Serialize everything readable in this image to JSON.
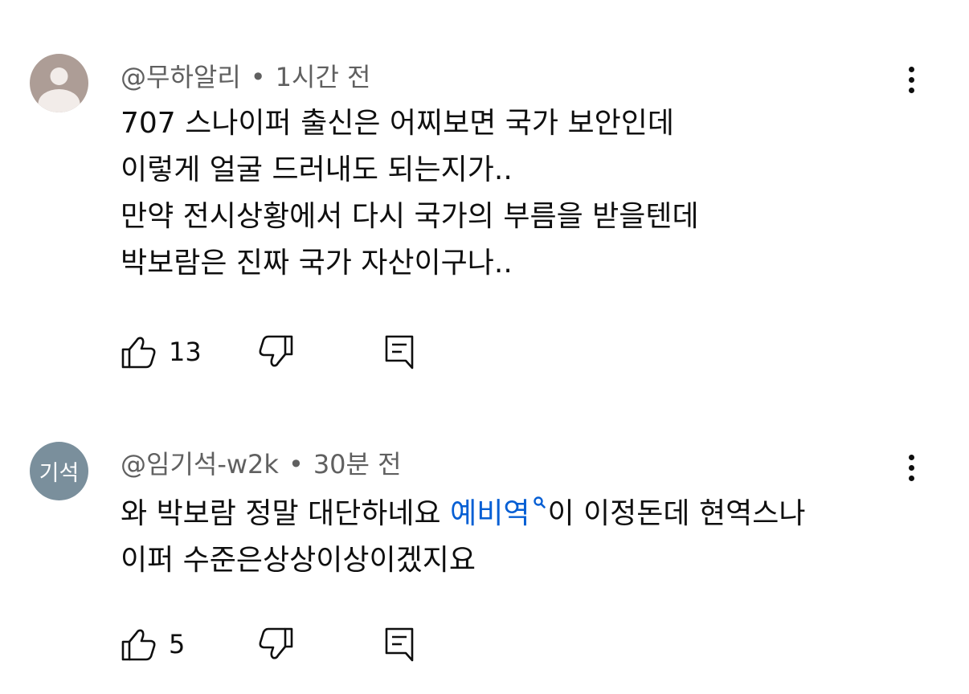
{
  "comments": [
    {
      "author": "@무하알리",
      "time": "1시간 전",
      "lines": [
        "707 스나이퍼 출신은 어찌보면 국가 보안인데",
        "이렇게 얼굴 드러내도 되는지가..",
        "만약 전시상황에서 다시 국가의 부름을 받을텐데",
        "박보람은 진짜 국가 자산이구나.."
      ],
      "likes": "13"
    },
    {
      "author": "@임기석-w2k",
      "avatar_text": "기석",
      "time": "30분 전",
      "line1_before": "와 박보람 정말 대단하네요 ",
      "line1_tag": "예비역",
      "line1_after": "이 이정돈데 현역스나",
      "line2": "이퍼 수준은상상이상이겠지요",
      "likes": "5"
    }
  ],
  "separator": "•",
  "icons": [
    "default-avatar-icon",
    "more-vert-icon",
    "thumb-up-icon",
    "thumb-down-icon",
    "reply-comment-icon",
    "search-icon"
  ],
  "colors": {
    "link": "#065fd4",
    "secondary_text": "#606060",
    "avatar2_bg": "#7a8f9c"
  }
}
